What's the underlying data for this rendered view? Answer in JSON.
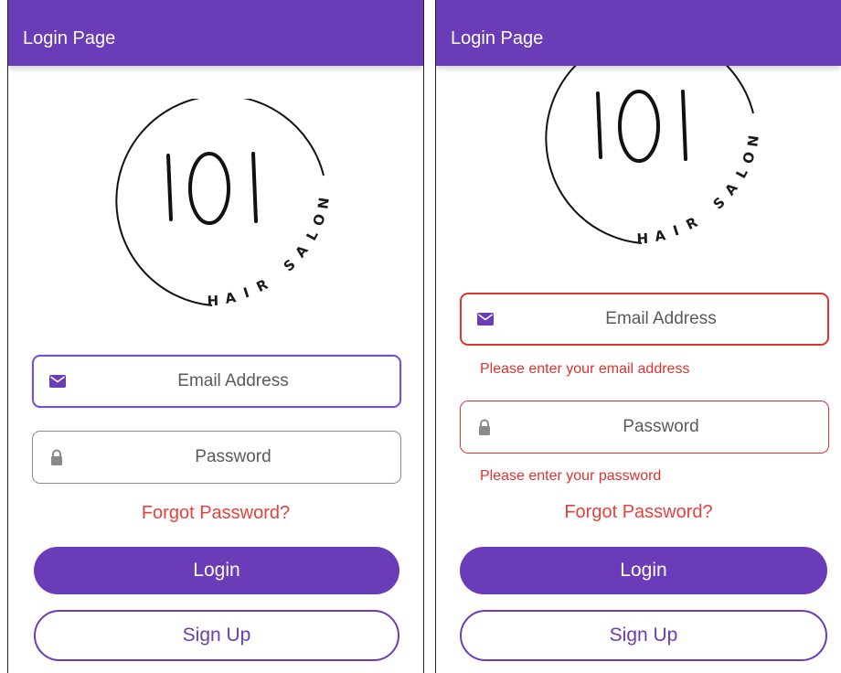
{
  "colors": {
    "primary": "#6a3cb8",
    "error": "#e0322c",
    "link_red": "#e8403a",
    "border_gray": "#8a8a8a"
  },
  "logo": {
    "mark": "IOI",
    "tagline": "HAIR SALON"
  },
  "left": {
    "title": "Login Page",
    "email": {
      "placeholder": "Email Address",
      "icon": "envelope-icon"
    },
    "password": {
      "placeholder": "Password",
      "icon": "lock-icon"
    },
    "forgot": "Forgot Password?",
    "login": "Login",
    "signup": "Sign Up"
  },
  "right": {
    "title": "Login Page",
    "email": {
      "placeholder": "Email Address",
      "icon": "envelope-icon",
      "error": "Please enter your email address"
    },
    "password": {
      "placeholder": "Password",
      "icon": "lock-icon",
      "error": "Please enter your password"
    },
    "forgot": "Forgot Password?",
    "login": "Login",
    "signup": "Sign Up"
  }
}
